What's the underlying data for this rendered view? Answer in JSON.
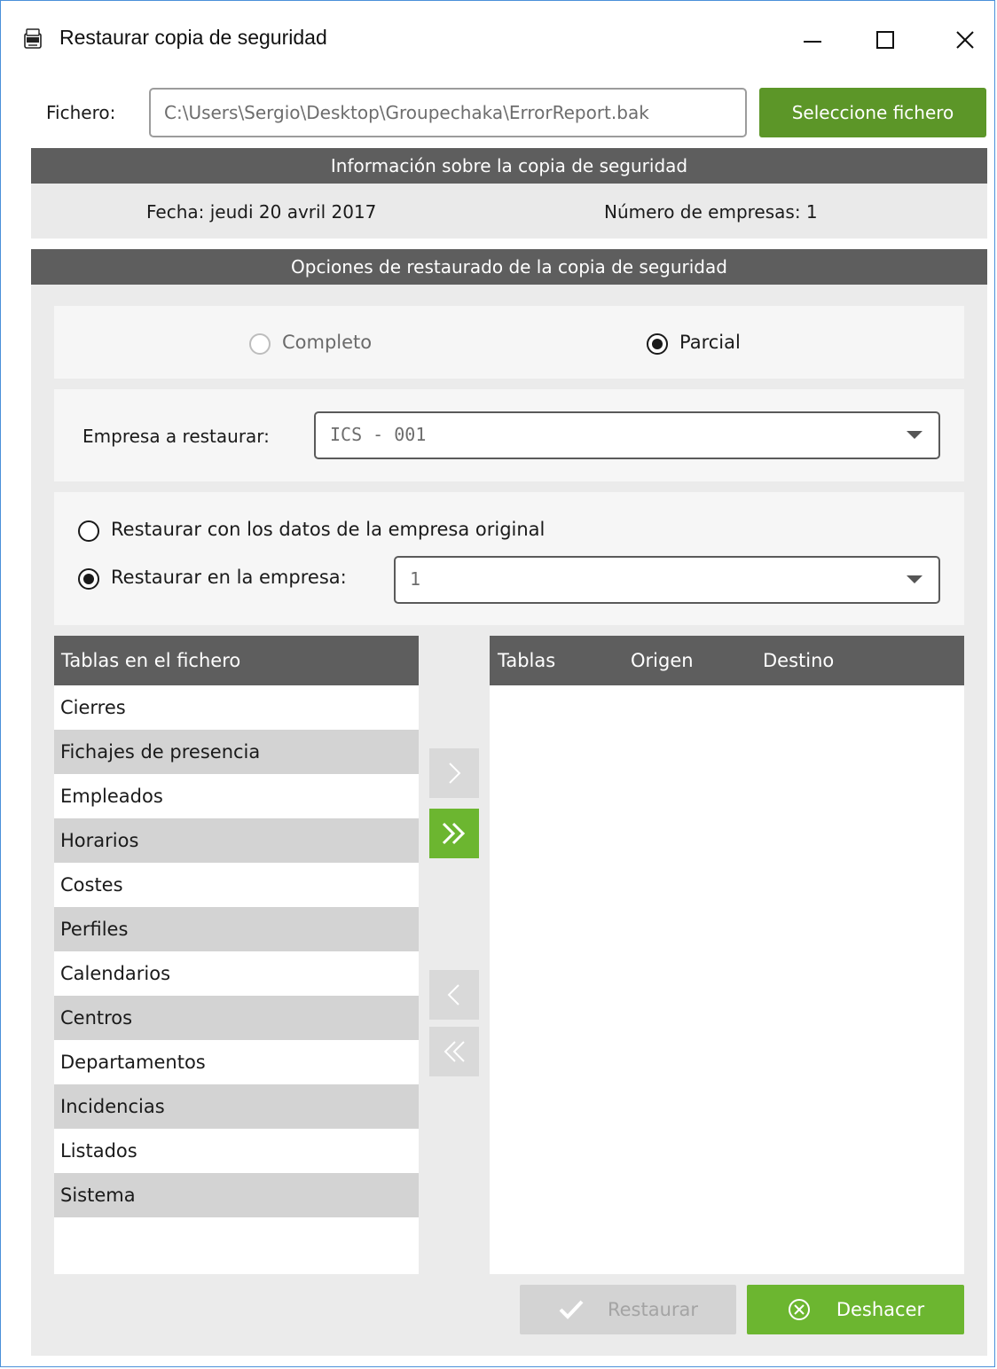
{
  "window": {
    "title": "Restaurar copia de seguridad",
    "icon": "bak-file-icon",
    "controls": [
      "minimize-icon",
      "maximize-icon",
      "close-icon"
    ]
  },
  "file": {
    "label": "Fichero:",
    "value": "C:\\Users\\Sergio\\Desktop\\Groupechaka\\ErrorReport.bak",
    "select_button": "Seleccione fichero"
  },
  "info": {
    "header": "Información sobre la copia de seguridad",
    "fecha": "Fecha: jeudi 20 avril 2017",
    "numero_empresas": "Número de empresas: 1"
  },
  "options": {
    "header": "Opciones de restaurado de la copia de seguridad",
    "mode": {
      "completo": "Completo",
      "parcial": "Parcial",
      "selected": "parcial"
    },
    "empresa_label": "Empresa a restaurar:",
    "empresa_value": "ICS - 001",
    "restore_original": "Restaurar con los datos de la empresa original",
    "restore_in": "Restaurar en la empresa:",
    "restore_in_value": "1",
    "restore_selected": "restore_in"
  },
  "source_list": {
    "header": "Tablas en el fichero",
    "items": [
      "Cierres",
      "Fichajes de presencia",
      "Empleados",
      "Horarios",
      "Costes",
      "Perfiles",
      "Calendarios",
      "Centros",
      "Departamentos",
      "Incidencias",
      "Listados",
      "Sistema"
    ]
  },
  "dest_list": {
    "columns": [
      "Tablas",
      "Origen",
      "Destino"
    ],
    "items": []
  },
  "buttons": {
    "restaurar": "Restaurar",
    "deshacer": "Deshacer"
  },
  "colors": {
    "accent_green": "#6cb630",
    "dark_green": "#5c9628",
    "header_gray": "#5e5e5e"
  }
}
